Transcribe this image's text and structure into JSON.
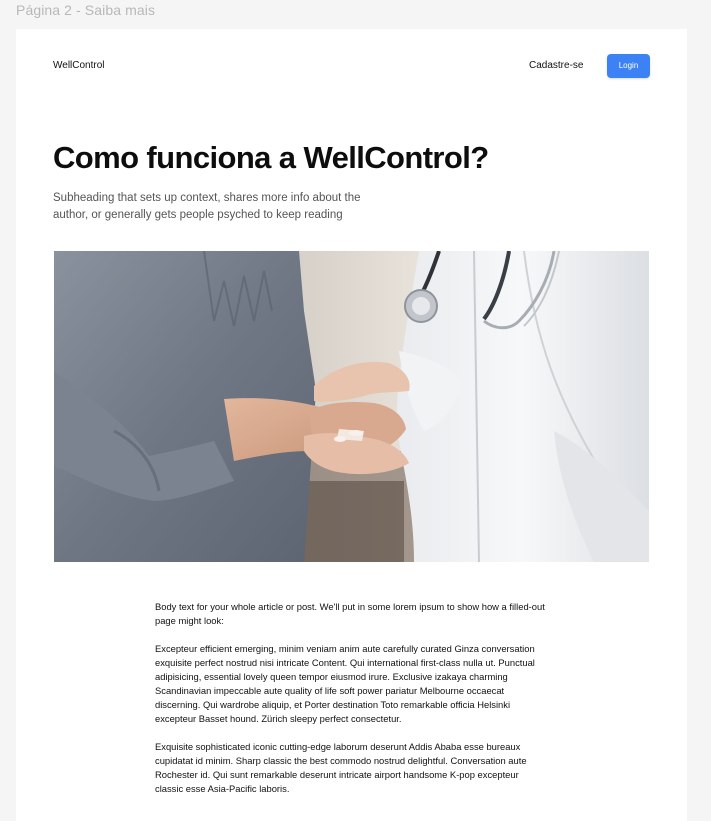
{
  "frame": {
    "label": "Página 2 - Saiba mais"
  },
  "nav": {
    "brand": "WellControl",
    "signup_label": "Cadastre-se",
    "login_label": "Login"
  },
  "hero": {
    "title": "Como funciona a WellControl?",
    "subtitle": "Subheading that sets up context, shares more info about the author, or generally gets people psyched to keep reading"
  },
  "article": {
    "paragraphs": [
      "Body text for your whole article or post. We'll put in some lorem ipsum to show how a filled-out page might look:",
      "Excepteur efficient emerging, minim veniam anim aute carefully curated Ginza conversation exquisite perfect nostrud nisi intricate Content. Qui  international first-class nulla ut. Punctual adipisicing, essential lovely queen tempor eiusmod irure. Exclusive izakaya charming Scandinavian impeccable aute quality of life soft power pariatur Melbourne occaecat discerning. Qui wardrobe aliquip, et Porter destination Toto remarkable officia Helsinki excepteur Basset hound. Zürich sleepy perfect consectetur.",
      "Exquisite sophisticated iconic cutting-edge laborum deserunt Addis Ababa esse bureaux cupidatat id minim. Sharp classic the best commodo nostrud delightful. Conversation aute Rochester id. Qui sunt remarkable deserunt intricate airport handsome K-pop excepteur classic esse Asia-Pacific laboris."
    ]
  },
  "colors": {
    "accent": "#3d82f4",
    "canvas": "#f5f5f5",
    "page": "#ffffff"
  }
}
